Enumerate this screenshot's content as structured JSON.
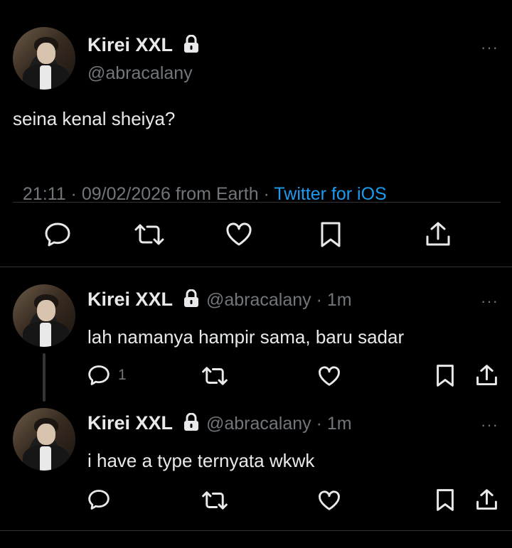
{
  "main_tweet": {
    "display_name": "Kirei XXL",
    "handle": "@abracalany",
    "text": "seina kenal sheiya?",
    "timestamp": "21:11 · 09/02/2026 from Earth · ",
    "source": "Twitter for iOS",
    "more": "···"
  },
  "replies": [
    {
      "display_name": "Kirei XXL",
      "handle": "@abracalany · 1m",
      "text": "lah namanya hampir sama, baru sadar",
      "reply_count": "1",
      "more": "···"
    },
    {
      "display_name": "Kirei XXL",
      "handle": "@abracalany · 1m",
      "text": "i have a type ternyata wkwk",
      "reply_count": "",
      "more": "···"
    }
  ],
  "icons": [
    "reply-icon",
    "retweet-icon",
    "like-icon",
    "bookmark-icon",
    "share-icon",
    "lock-icon",
    "more-icon"
  ]
}
